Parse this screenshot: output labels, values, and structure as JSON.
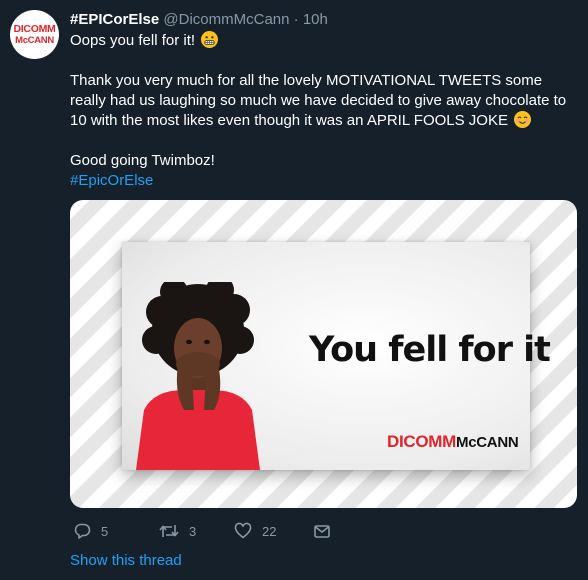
{
  "tweet": {
    "avatar": {
      "line1": "DICOMM",
      "line2": "McCANN"
    },
    "display_name": "#EPICorElse",
    "handle": "@DicommMcCann",
    "separator": "·",
    "time": "10h",
    "line1": "Oops you fell for it!",
    "line1_emoji": "grimacing-emoji",
    "paragraph2": "Thank you very much for all the lovely MOTIVATIONAL TWEETS some really had us laughing so much we have decided to give away chocolate to 10 with the most likes even though it was an APRIL FOOLS JOKE",
    "paragraph2_emoji": "smiling-blush-emoji",
    "paragraph3": "Good going Twimboz!",
    "hashtag": "#EpicOrElse"
  },
  "media": {
    "headline": "You fell for it",
    "brand_red": "DICOMM",
    "brand_black": "McCANN"
  },
  "actions": {
    "reply_count": "5",
    "retweet_count": "3",
    "like_count": "22"
  },
  "footer": {
    "show_thread": "Show this thread"
  },
  "colors": {
    "background": "#15202b",
    "link": "#1da1f2",
    "muted": "#8899a6",
    "brand_red": "#e0262b"
  }
}
